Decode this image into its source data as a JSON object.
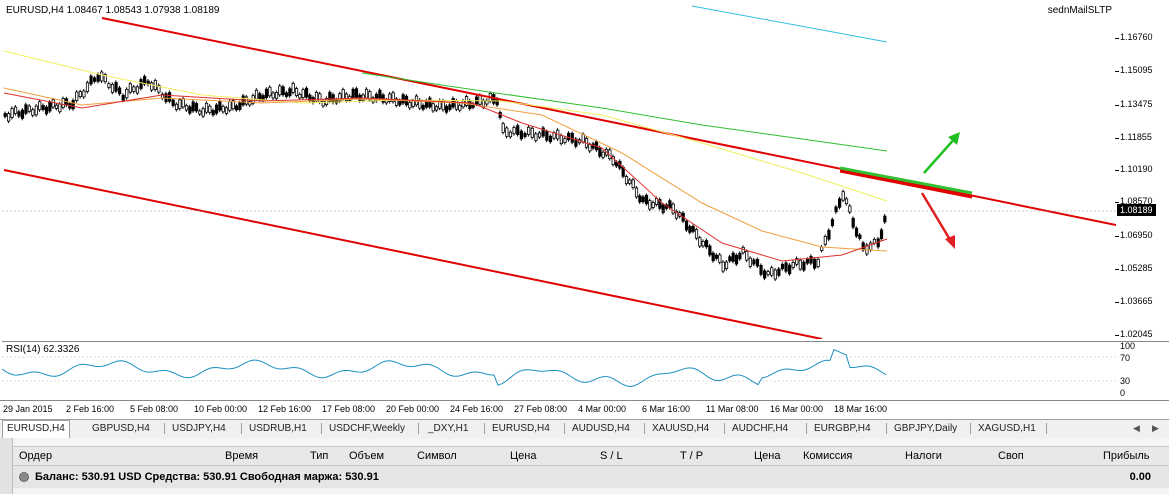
{
  "chart": {
    "title": "EURUSD,H4  1.08467 1.08543 1.07938 1.08189",
    "expert": "sednMailSLTP",
    "current_price": "1.08189",
    "price_ticks": [
      "1.16760",
      "1.15095",
      "1.13475",
      "1.11855",
      "1.10190",
      "1.08570",
      "1.06950",
      "1.05285",
      "1.03665",
      "1.02045"
    ],
    "rsi_title": "RSI(14) 62.3326",
    "rsi_ticks": [
      "100",
      "70",
      "30",
      "0"
    ],
    "time_ticks": [
      "29 Jan 2015",
      "2 Feb 16:00",
      "5 Feb 08:00",
      "10 Feb 00:00",
      "12 Feb 16:00",
      "17 Feb 08:00",
      "20 Feb 00:00",
      "24 Feb 16:00",
      "27 Feb 08:00",
      "4 Mar 00:00",
      "6 Mar 16:00",
      "11 Mar 08:00",
      "16 Mar 00:00",
      "18 Mar 16:00"
    ],
    "colors": {
      "bull": "#000000",
      "channel": "#e00000",
      "ma_fast": "#e03030",
      "ma_mid": "#f0a040",
      "ma_slow": "#f0f060",
      "ma_long": "#30c030",
      "ma_cyan": "#30c0e0",
      "arrow_up": "#20c020",
      "arrow_down": "#e02020"
    }
  },
  "tabs": [
    {
      "label": "EURUSD,H4",
      "active": true
    },
    {
      "label": "GBPUSD,H4"
    },
    {
      "label": "USDJPY,H4"
    },
    {
      "label": "USDRUB,H1"
    },
    {
      "label": "USDCHF,Weekly"
    },
    {
      "label": "_DXY,H1"
    },
    {
      "label": "EURUSD,H4"
    },
    {
      "label": "AUDUSD,H4"
    },
    {
      "label": "XAUUSD,H4"
    },
    {
      "label": "AUDCHF,H4"
    },
    {
      "label": "EURGBP,H4"
    },
    {
      "label": "GBPJPY,Daily"
    },
    {
      "label": "XAGUSD,H1"
    }
  ],
  "terminal": {
    "columns": [
      "Ордер",
      "Время",
      "Тип",
      "Объем",
      "Символ",
      "Цена",
      "S / L",
      "T / P",
      "Цена",
      "Комиссия",
      "Налоги",
      "Своп",
      "Прибыль"
    ],
    "balance": "Баланс: 530.91 USD  Средства: 530.91  Свободная маржа: 530.91",
    "profit": "0.00"
  }
}
